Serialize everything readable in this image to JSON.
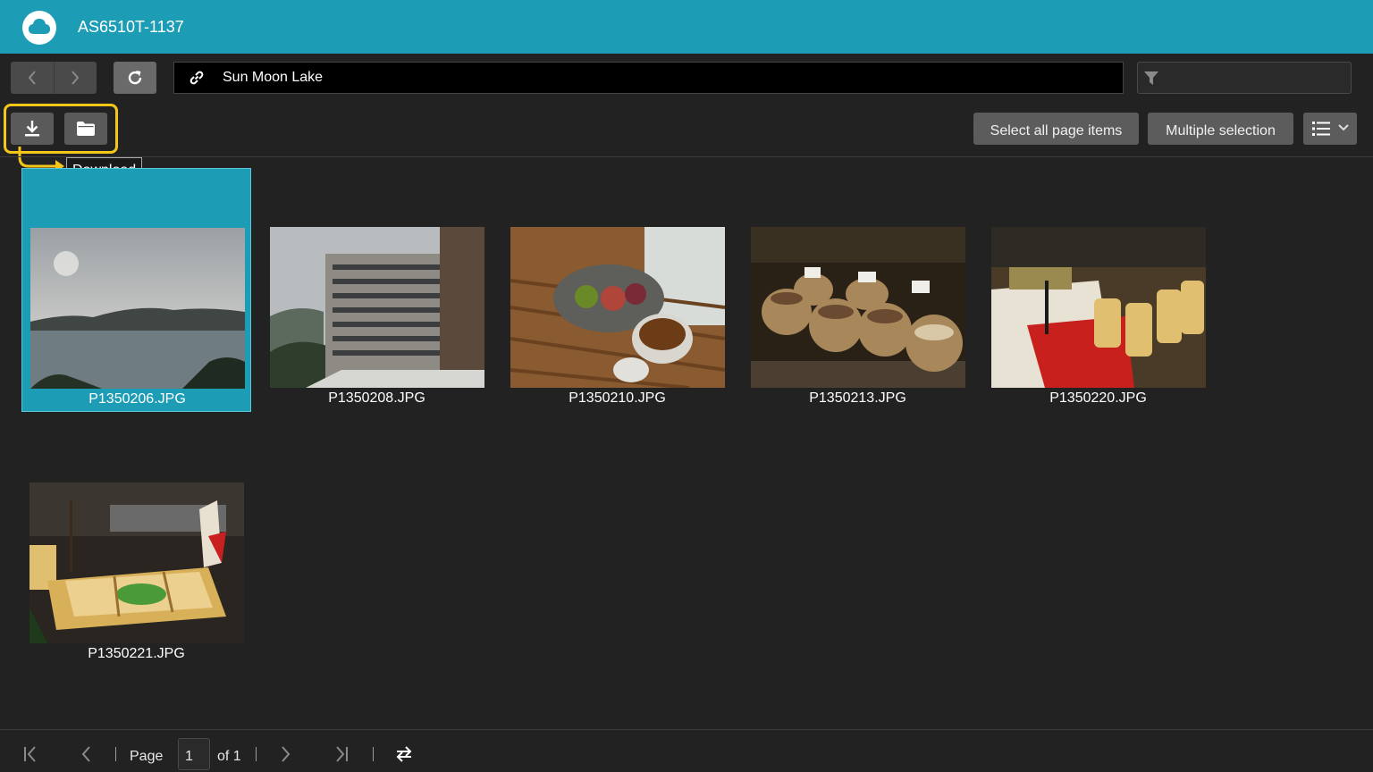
{
  "app": {
    "title": "AS6510T-1137",
    "logo_icon": "cloud-icon"
  },
  "toolbar": {
    "back_icon": "chevron-left-icon",
    "forward_icon": "chevron-right-icon",
    "refresh_icon": "refresh-icon",
    "path_icon": "link-icon",
    "path": "Sun Moon Lake",
    "filter_icon": "filter-icon",
    "filter_value": "",
    "download_icon": "download-icon",
    "folder_icon": "folder-icon",
    "download_tooltip": "Download",
    "select_all_label": "Select all page items",
    "multiple_selection_label": "Multiple selection",
    "view_icon": "list-view-icon"
  },
  "annotation": {
    "highlight_color": "#f5c61a"
  },
  "files": [
    {
      "name": "P1350206.JPG",
      "selected": true
    },
    {
      "name": "P1350208.JPG",
      "selected": false
    },
    {
      "name": "P1350210.JPG",
      "selected": false
    },
    {
      "name": "P1350213.JPG",
      "selected": false
    },
    {
      "name": "P1350220.JPG",
      "selected": false
    },
    {
      "name": "P1350221.JPG",
      "selected": false
    }
  ],
  "pager": {
    "page_label": "Page",
    "current_page": "1",
    "of_label": "of 1"
  },
  "colors": {
    "accent": "#1c9cb5",
    "background": "#222222"
  }
}
